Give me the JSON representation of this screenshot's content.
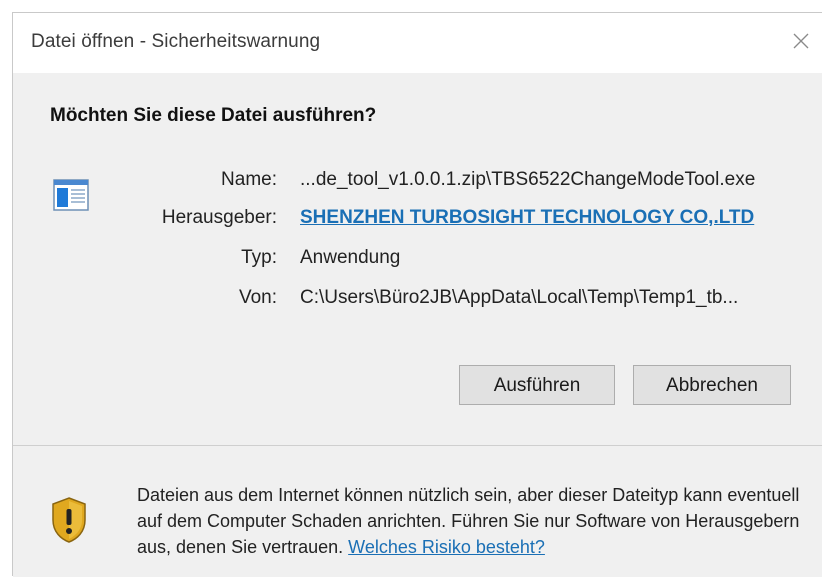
{
  "window": {
    "title": "Datei öffnen - Sicherheitswarnung",
    "close_icon": "close-icon"
  },
  "question": "Möchten Sie diese Datei ausführen?",
  "file_icon": "application-file-icon",
  "details": [
    {
      "label": "Name:",
      "value": "...de_tool_v1.0.0.1.zip\\TBS6522ChangeModeTool.exe"
    },
    {
      "label": "Herausgeber:",
      "value": "SHENZHEN TURBOSIGHT TECHNOLOGY CO,.LTD"
    },
    {
      "label": "Typ:",
      "value": "Anwendung"
    },
    {
      "label": "Von:",
      "value": "C:\\Users\\Büro2JB\\AppData\\Local\\Temp\\Temp1_tb..."
    }
  ],
  "buttons": {
    "run": "Ausführen",
    "cancel": "Abbrechen"
  },
  "warning": {
    "icon": "shield-warning-icon",
    "text": "Dateien aus dem Internet können nützlich sein, aber dieser Dateityp kann eventuell auf dem Computer Schaden anrichten. Führen Sie nur Software von Herausgebern aus, denen Sie vertrauen.",
    "link": "Welches Risiko besteht?"
  },
  "colors": {
    "link": "#1a6fb5",
    "dialog_bg": "#f0f0f0",
    "button_bg": "#e1e1e1",
    "shield_gold": "#e0a81f"
  }
}
